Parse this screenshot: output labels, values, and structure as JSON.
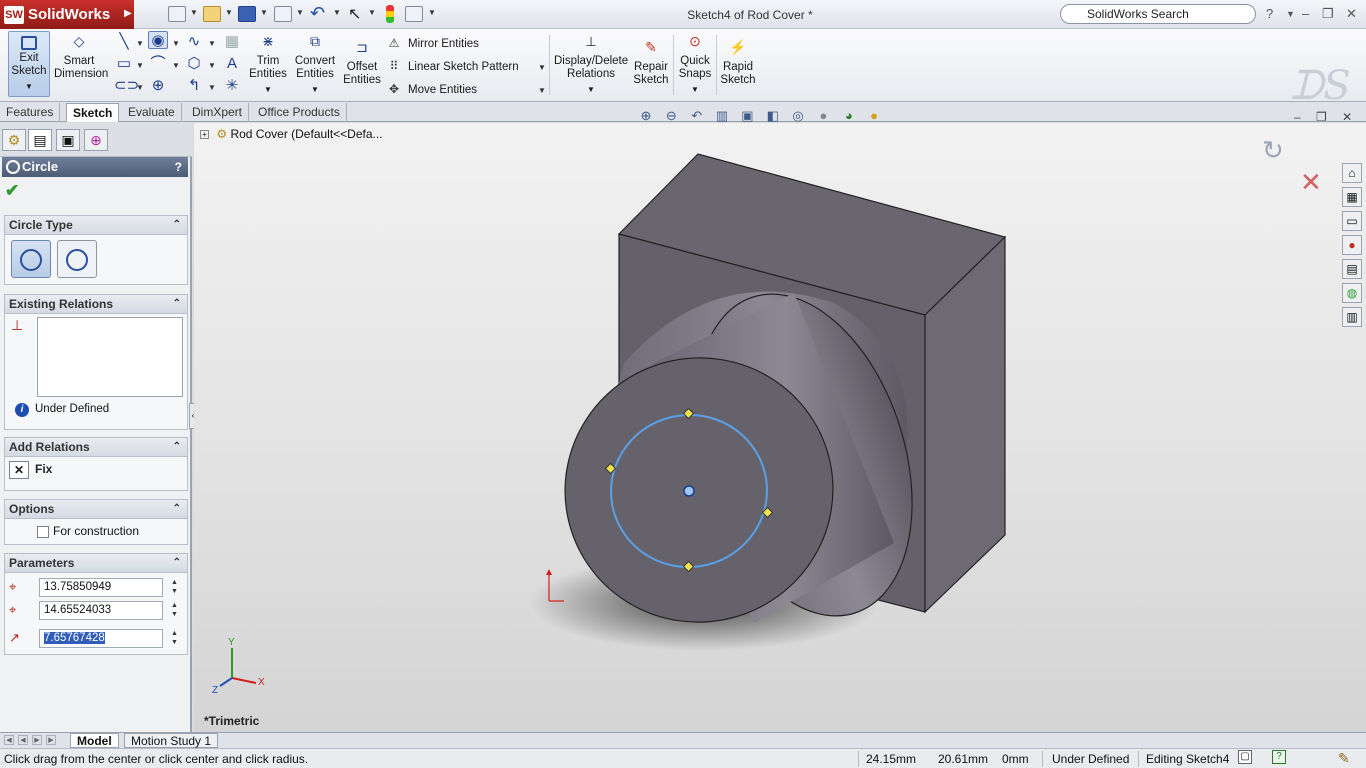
{
  "app": {
    "logo_text": "SolidWorks",
    "doc_title": "Sketch4 of Rod Cover *",
    "search_placeholder": "SolidWorks Search"
  },
  "ribbon": {
    "exit_sketch": "Exit Sketch",
    "smart_dimension": "Smart Dimension",
    "trim_entities": "Trim Entities",
    "convert_entities": "Convert Entities",
    "offset_entities": "Offset Entities",
    "mirror_entities": "Mirror Entities",
    "linear_sketch_pattern": "Linear Sketch Pattern",
    "move_entities": "Move Entities",
    "display_delete_relations": "Display/Delete Relations",
    "repair_sketch": "Repair Sketch",
    "quick_snaps": "Quick Snaps",
    "rapid_sketch": "Rapid Sketch"
  },
  "tabs": [
    "Features",
    "Sketch",
    "Evaluate",
    "DimXpert",
    "Office Products"
  ],
  "property_manager": {
    "title": "Circle",
    "circle_type": {
      "header": "Circle Type"
    },
    "existing_relations": {
      "header": "Existing Relations",
      "status": "Under Defined"
    },
    "add_relations": {
      "header": "Add Relations",
      "fix": "Fix"
    },
    "options": {
      "header": "Options",
      "for_construction": "For construction"
    },
    "parameters": {
      "header": "Parameters",
      "center_x": "13.75850949",
      "center_y": "14.65524033",
      "radius": "7.65767428"
    }
  },
  "viewport": {
    "tree_item": "Rod Cover  (Default<<Defa...",
    "view_name": "*Trimetric"
  },
  "bottom_tabs": [
    "Model",
    "Motion Study 1"
  ],
  "status": {
    "message": "Click drag from the center or click center and click radius.",
    "x": "24.15mm",
    "y": "20.61mm",
    "z": "0mm",
    "state": "Under Defined",
    "editing": "Editing Sketch4"
  },
  "colors": {
    "sketch_circle": "#5aa0e6",
    "part_face": "#6c6874",
    "accent": "#4c5b76"
  }
}
